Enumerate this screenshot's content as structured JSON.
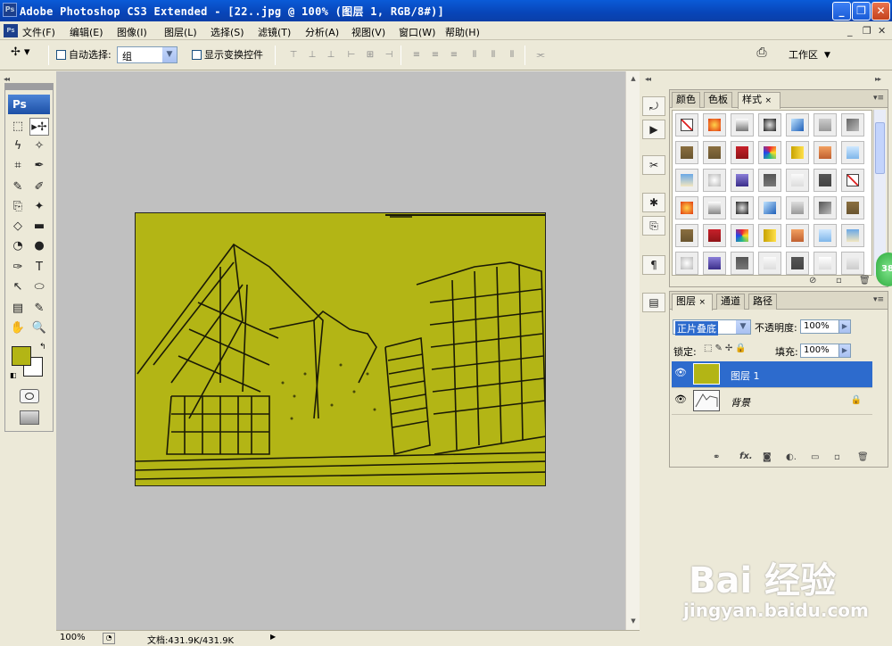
{
  "window": {
    "title": "Adobe Photoshop CS3 Extended - [22..jpg @ 100% (图层 1, RGB/8#)]",
    "app_icon": "Ps",
    "controls": [
      "_",
      "❐",
      "✕"
    ]
  },
  "menubar": {
    "doc_icon": "Ps",
    "items": [
      "文件(F)",
      "编辑(E)",
      "图像(I)",
      "图层(L)",
      "选择(S)",
      "滤镜(T)",
      "分析(A)",
      "视图(V)",
      "窗口(W)",
      "帮助(H)"
    ],
    "doc_controls": [
      "_",
      "❐",
      "✕"
    ]
  },
  "options": {
    "auto_select_label": "自动选择:",
    "auto_select_value": "组",
    "show_transform_label": "显示变换控件",
    "workspace_label": "工作区"
  },
  "toolbox": {
    "logo": "Ps",
    "tools": [
      "⬚",
      "▸✢",
      "ϟ",
      "✧",
      "⌗",
      "✒",
      "✎",
      "✐",
      "⎘",
      "✦",
      "◇",
      "▬",
      "◔",
      "●",
      "✑",
      "T",
      "↖",
      "⬭",
      "▤",
      "✎",
      "✋",
      "🔍"
    ],
    "foreground_color": "#b3b515",
    "background_color": "#ffffff"
  },
  "document": {
    "image_fill": "#b3b515",
    "canvas_bg": "#c0c0c0"
  },
  "status": {
    "zoom": "100%",
    "doc_info": "文档:431.9K/431.9K"
  },
  "styles_panel": {
    "tabs": [
      "颜色",
      "色板",
      "样式"
    ],
    "active_tab": "样式"
  },
  "layers_panel": {
    "tabs": [
      "图层",
      "通道",
      "路径"
    ],
    "active_tab": "图层",
    "blend_mode": "正片叠底",
    "opacity_label": "不透明度:",
    "opacity_value": "100%",
    "lock_label": "锁定:",
    "fill_label": "填充:",
    "fill_value": "100%",
    "layers": [
      {
        "name": "图层 1",
        "selected": true
      },
      {
        "name": "背景",
        "selected": false,
        "locked": true
      }
    ]
  },
  "bubble": "38",
  "watermark": {
    "brand": "Bai 经验",
    "url": "jingyan.baidu.com"
  }
}
